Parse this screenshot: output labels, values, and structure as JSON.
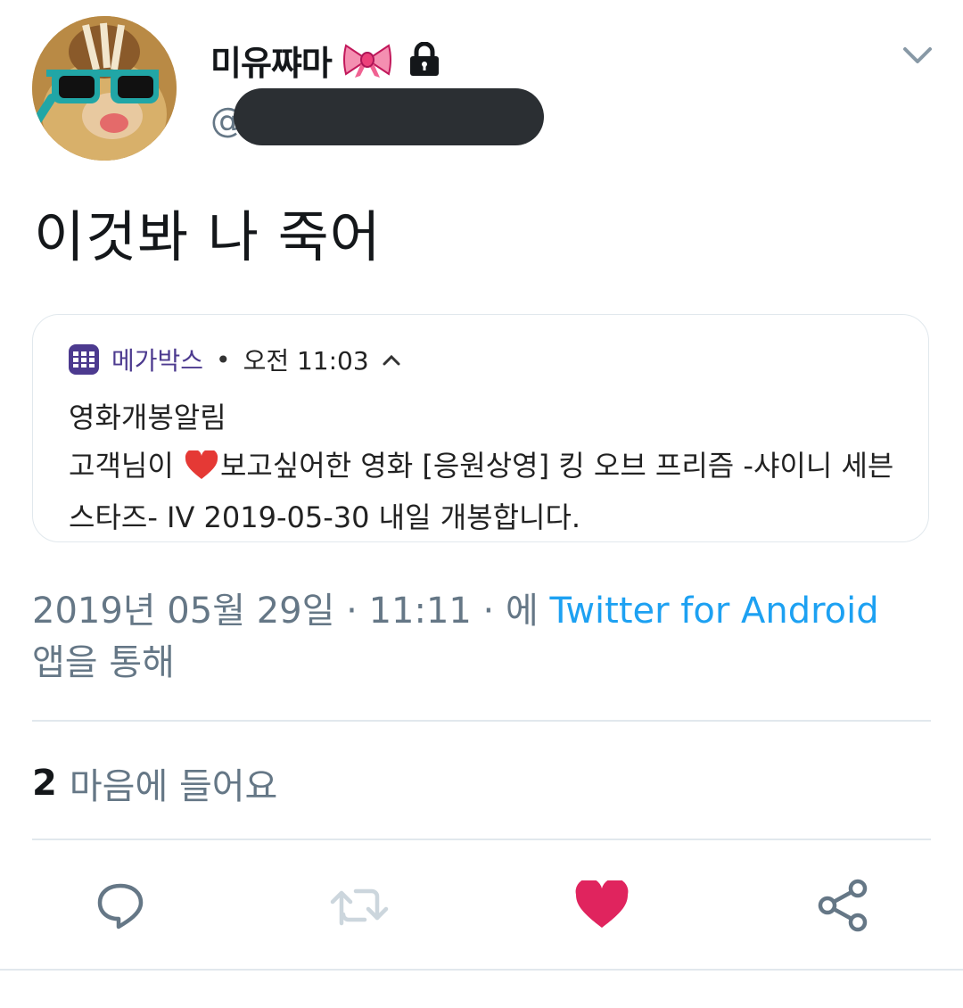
{
  "author": {
    "display_name": "미유쨔마",
    "handle_prefix": "@"
  },
  "tweet": {
    "text": "이것봐 나 죽어"
  },
  "notification": {
    "app_name": "메가박스",
    "separator": "•",
    "time": "오전 11:03",
    "title": "영화개봉알림",
    "body_before": "고객님이 ",
    "body_after": "보고싶어한 영화 [응원상영] 킹 오브 프리즘 -샤이니 세븐 스타즈- IV 2019-05-30 내일 개봉합니다."
  },
  "meta": {
    "timestamp": "2019년 05월 29일 · 11:11 · 에 ",
    "source": "Twitter for Android",
    "suffix": "앱을 통해"
  },
  "stats": {
    "like_count": "2",
    "like_label": "마음에 들어요"
  },
  "actions": {
    "reply_icon": "reply-icon",
    "retweet_icon": "retweet-icon",
    "like_icon": "heart-icon",
    "share_icon": "share-icon"
  },
  "colors": {
    "link": "#1da1f2",
    "liked": "#e0245e",
    "muted": "#657786",
    "text": "#14171a",
    "divider": "#e1e8ed"
  }
}
